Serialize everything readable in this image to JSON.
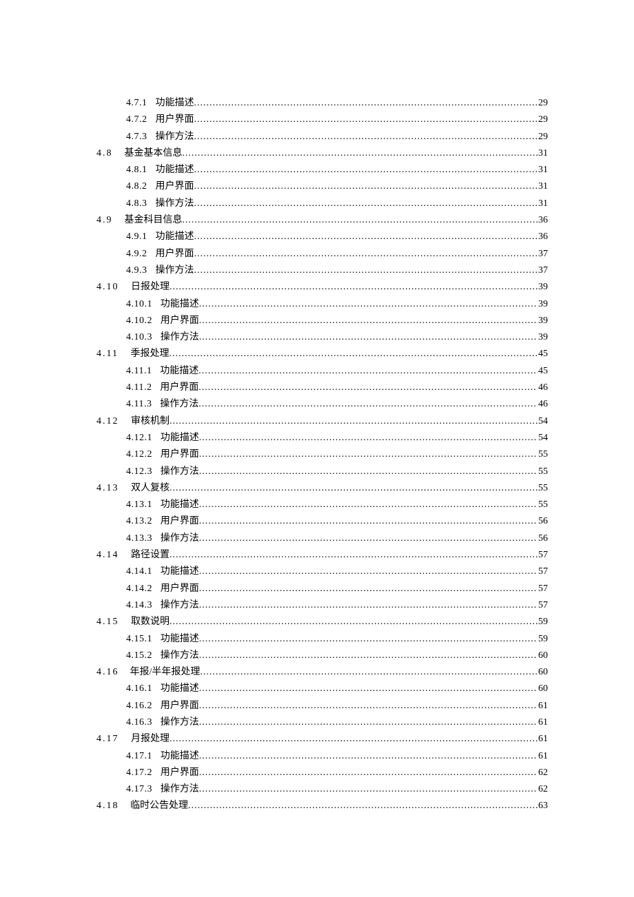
{
  "entries": [
    {
      "level": 2,
      "num": "4.7.1",
      "label": "功能描述",
      "page": 29
    },
    {
      "level": 2,
      "num": "4.7.2",
      "label": "用户界面",
      "page": 29
    },
    {
      "level": 2,
      "num": "4.7.3",
      "label": "操作方法",
      "page": 29
    },
    {
      "level": 1,
      "num": "4.8",
      "label": "基金基本信息",
      "page": 31
    },
    {
      "level": 2,
      "num": "4.8.1",
      "label": "功能描述",
      "page": 31
    },
    {
      "level": 2,
      "num": "4.8.2",
      "label": "用户界面",
      "page": 31
    },
    {
      "level": 2,
      "num": "4.8.3",
      "label": "操作方法",
      "page": 31
    },
    {
      "level": 1,
      "num": "4.9",
      "label": "基金科目信息",
      "page": 36
    },
    {
      "level": 2,
      "num": "4.9.1",
      "label": "功能描述",
      "page": 36
    },
    {
      "level": 2,
      "num": "4.9.2",
      "label": "用户界面",
      "page": 37
    },
    {
      "level": 2,
      "num": "4.9.3",
      "label": "操作方法",
      "page": 37
    },
    {
      "level": 1,
      "num": "4.10",
      "label": "日报处理",
      "page": 39
    },
    {
      "level": 2,
      "num": "4.10.1",
      "label": "功能描述",
      "page": 39
    },
    {
      "level": 2,
      "num": "4.10.2",
      "label": "用户界面",
      "page": 39
    },
    {
      "level": 2,
      "num": "4.10.3",
      "label": "操作方法",
      "page": 39
    },
    {
      "level": 1,
      "num": "4.11",
      "label": "季报处理",
      "page": 45
    },
    {
      "level": 2,
      "num": "4.11.1",
      "label": "功能描述",
      "page": 45
    },
    {
      "level": 2,
      "num": "4.11.2",
      "label": "用户界面",
      "page": 46
    },
    {
      "level": 2,
      "num": "4.11.3",
      "label": "操作方法",
      "page": 46
    },
    {
      "level": 1,
      "num": "4.12",
      "label": "审核机制",
      "page": 54
    },
    {
      "level": 2,
      "num": "4.12.1",
      "label": "功能描述",
      "page": 54
    },
    {
      "level": 2,
      "num": "4.12.2",
      "label": "用户界面",
      "page": 55
    },
    {
      "level": 2,
      "num": "4.12.3",
      "label": "操作方法",
      "page": 55
    },
    {
      "level": 1,
      "num": "4.13",
      "label": "双人复核",
      "page": 55
    },
    {
      "level": 2,
      "num": "4.13.1",
      "label": "功能描述",
      "page": 55
    },
    {
      "level": 2,
      "num": "4.13.2",
      "label": "用户界面",
      "page": 56
    },
    {
      "level": 2,
      "num": "4.13.3",
      "label": "操作方法",
      "page": 56
    },
    {
      "level": 1,
      "num": "4.14",
      "label": "路径设置",
      "page": 57
    },
    {
      "level": 2,
      "num": "4.14.1",
      "label": "功能描述",
      "page": 57
    },
    {
      "level": 2,
      "num": "4.14.2",
      "label": "用户界面",
      "page": 57
    },
    {
      "level": 2,
      "num": "4.14.3",
      "label": "操作方法",
      "page": 57
    },
    {
      "level": 1,
      "num": "4.15",
      "label": "取数说明",
      "page": 59
    },
    {
      "level": 2,
      "num": "4.15.1",
      "label": "功能描述",
      "page": 59
    },
    {
      "level": 2,
      "num": "4.15.2",
      "label": "操作方法",
      "page": 60
    },
    {
      "level": 1,
      "num": "4.16",
      "label": "年报/半年报处理",
      "page": 60
    },
    {
      "level": 2,
      "num": "4.16.1",
      "label": "功能描述",
      "page": 60
    },
    {
      "level": 2,
      "num": "4.16.2",
      "label": "用户界面",
      "page": 61
    },
    {
      "level": 2,
      "num": "4.16.3",
      "label": "操作方法",
      "page": 61
    },
    {
      "level": 1,
      "num": "4.17",
      "label": "月报处理",
      "page": 61
    },
    {
      "level": 2,
      "num": "4.17.1",
      "label": "功能描述",
      "page": 61
    },
    {
      "level": 2,
      "num": "4.17.2",
      "label": "用户界面",
      "page": 62
    },
    {
      "level": 2,
      "num": "4.17.3",
      "label": "操作方法",
      "page": 62
    },
    {
      "level": 1,
      "num": "4.18",
      "label": "临时公告处理",
      "page": 63
    }
  ]
}
